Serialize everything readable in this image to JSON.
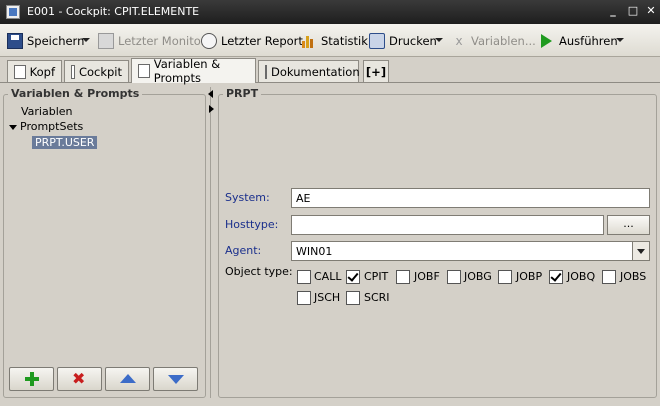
{
  "window": {
    "title": "E001 - Cockpit: CPIT.ELEMENTE"
  },
  "toolbar": {
    "save_label": "Speichern",
    "last_monitor_label": "Letzter Monitor",
    "last_report_label": "Letzter Report",
    "statistics_label": "Statistik",
    "print_label": "Drucken",
    "variables_label": "Variablen...",
    "execute_label": "Ausführen"
  },
  "tabs": [
    {
      "label": "Kopf",
      "active": false
    },
    {
      "label": "Cockpit",
      "active": false
    },
    {
      "label": "Variablen & Prompts",
      "active": true
    },
    {
      "label": "Dokumentation",
      "active": false
    },
    {
      "label": "[+]",
      "active": false
    }
  ],
  "left_panel": {
    "title": "Variablen & Prompts",
    "tree": {
      "variables": "Variablen",
      "promptsets": "PromptSets",
      "selected_child": "PRPT.USER"
    }
  },
  "right_panel": {
    "title": "PRPT",
    "system": {
      "label": "System:",
      "value": "AE"
    },
    "hosttype": {
      "label": "Hosttype:",
      "value": "",
      "browse_label": "..."
    },
    "agent": {
      "label": "Agent:",
      "value": "WIN01"
    },
    "object_type": {
      "label": "Object type:",
      "options": [
        {
          "label": "CALL",
          "checked": false
        },
        {
          "label": "CPIT",
          "checked": true
        },
        {
          "label": "JOBF",
          "checked": false
        },
        {
          "label": "JOBG",
          "checked": false
        },
        {
          "label": "JOBP",
          "checked": false
        },
        {
          "label": "JOBQ",
          "checked": true
        },
        {
          "label": "JOBS",
          "checked": false
        },
        {
          "label": "JSCH",
          "checked": false
        },
        {
          "label": "SCRI",
          "checked": false
        }
      ]
    }
  },
  "colors": {
    "accent_blue": "#1a2f8c",
    "selection": "#6a7b9a",
    "add_green": "#1f9a1f",
    "delete_red": "#c81e1e",
    "arrow_blue": "#3c6cc8"
  }
}
